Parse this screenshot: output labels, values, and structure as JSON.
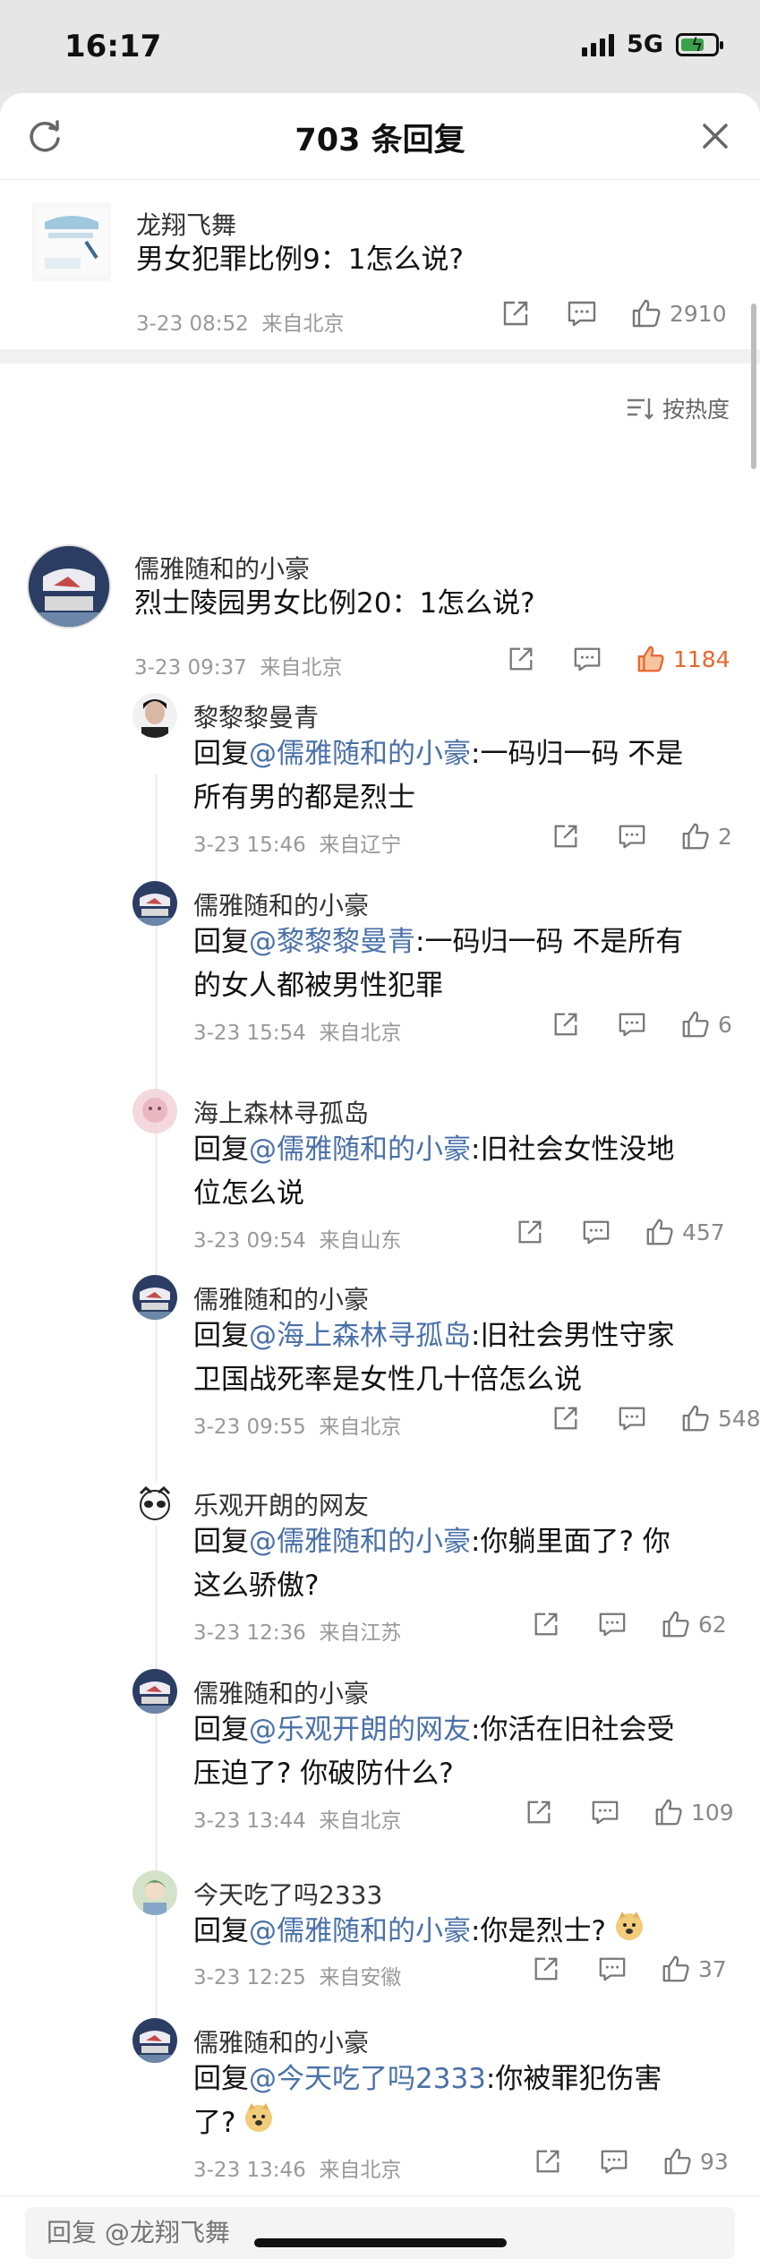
{
  "status_bar": {
    "time": "16:17",
    "network": "5G"
  },
  "header": {
    "title": "703 条回复"
  },
  "original_post": {
    "author": "龙翔飞舞",
    "text": "男女犯罪比例9：1怎么说?",
    "time": "3-23 08:52",
    "location": "来自北京",
    "likes": "2910"
  },
  "sort": {
    "label": "按热度"
  },
  "top_comment": {
    "author": "儒雅随和的小豪",
    "text": "烈士陵园男女比例20：1怎么说?",
    "time": "3-23 09:37",
    "location": "来自北京",
    "likes": "1184"
  },
  "replies": [
    {
      "author": "黎黎黎曼青",
      "prefix": "回复",
      "mention": "@儒雅随和的小豪",
      "line1": ":一码归一码 不是",
      "line2": "所有男的都是烈士",
      "time": "3-23 15:46",
      "location": "来自辽宁",
      "likes": "2"
    },
    {
      "author": "儒雅随和的小豪",
      "prefix": "回复",
      "mention": "@黎黎黎曼青",
      "line1": ":一码归一码  不是所有",
      "line2": "的女人都被男性犯罪",
      "time": "3-23 15:54",
      "location": "来自北京",
      "likes": "6"
    },
    {
      "author": "海上森林寻孤岛",
      "prefix": "回复",
      "mention": "@儒雅随和的小豪",
      "line1": ":旧社会女性没地",
      "line2": "位怎么说",
      "time": "3-23 09:54",
      "location": "来自山东",
      "likes": "457"
    },
    {
      "author": "儒雅随和的小豪",
      "prefix": "回复",
      "mention": "@海上森林寻孤岛",
      "line1": ":旧社会男性守家",
      "line2": "卫国战死率是女性几十倍怎么说",
      "time": "3-23 09:55",
      "location": "来自北京",
      "likes": "548"
    },
    {
      "author": "乐观开朗的网友",
      "prefix": "回复",
      "mention": "@儒雅随和的小豪",
      "line1": ":你躺里面了? 你",
      "line2": "这么骄傲?",
      "time": "3-23 12:36",
      "location": "来自江苏",
      "likes": "62"
    },
    {
      "author": "儒雅随和的小豪",
      "prefix": "回复",
      "mention": "@乐观开朗的网友",
      "line1": ":你活在旧社会受",
      "line2": "压迫了? 你破防什么?",
      "time": "3-23 13:44",
      "location": "来自北京",
      "likes": "109"
    },
    {
      "author": "今天吃了吗2333",
      "prefix": "回复",
      "mention": "@儒雅随和的小豪",
      "line1": ":你是烈士?",
      "line2": "",
      "time": "3-23 12:25",
      "location": "来自安徽",
      "likes": "37"
    },
    {
      "author": "儒雅随和的小豪",
      "prefix": "回复",
      "mention": "@今天吃了吗2333",
      "line1": ":你被罪犯伤害",
      "line2": "了?",
      "time": "3-23 13:46",
      "location": "来自北京",
      "likes": "93"
    }
  ],
  "reply_bar": {
    "placeholder": "回复 @龙翔飞舞"
  }
}
